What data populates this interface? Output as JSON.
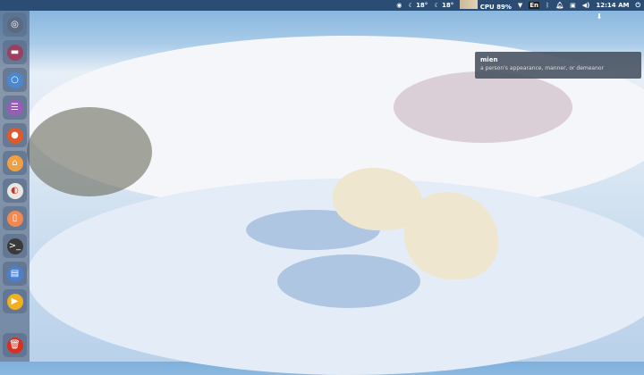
{
  "panel": {
    "temp1": "18°",
    "temp2": "18°",
    "cpu": "CPU 89%",
    "keyboard": "En",
    "clock": "12:14 AM"
  },
  "tooltip": {
    "word": "mien",
    "definition": "a person's appearance, manner, or demeanor"
  },
  "launcher": {
    "items": [
      {
        "name": "dash-home",
        "color": "#5a6a80",
        "glyph": "◎"
      },
      {
        "name": "files",
        "color": "#9a4060",
        "glyph": "▬"
      },
      {
        "name": "chromium",
        "color": "#4a88d0",
        "glyph": "○"
      },
      {
        "name": "text-editor",
        "color": "#9a5ab8",
        "glyph": "☰"
      },
      {
        "name": "firefox",
        "color": "#e05a28",
        "glyph": "●"
      },
      {
        "name": "software-center",
        "color": "#f0a040",
        "glyph": "⌂"
      },
      {
        "name": "system-settings",
        "color": "#e8e8e0",
        "glyph": "◐"
      },
      {
        "name": "speakers",
        "color": "#f08850",
        "glyph": "▯"
      },
      {
        "name": "terminal",
        "color": "#3a3a3a",
        "glyph": ">_"
      },
      {
        "name": "window-manager",
        "color": "#4a80d0",
        "glyph": "▤"
      },
      {
        "name": "media-player",
        "color": "#f0b020",
        "glyph": "▶"
      }
    ],
    "trash": {
      "name": "trash",
      "color": "#d83020",
      "glyph": "🗑"
    }
  }
}
